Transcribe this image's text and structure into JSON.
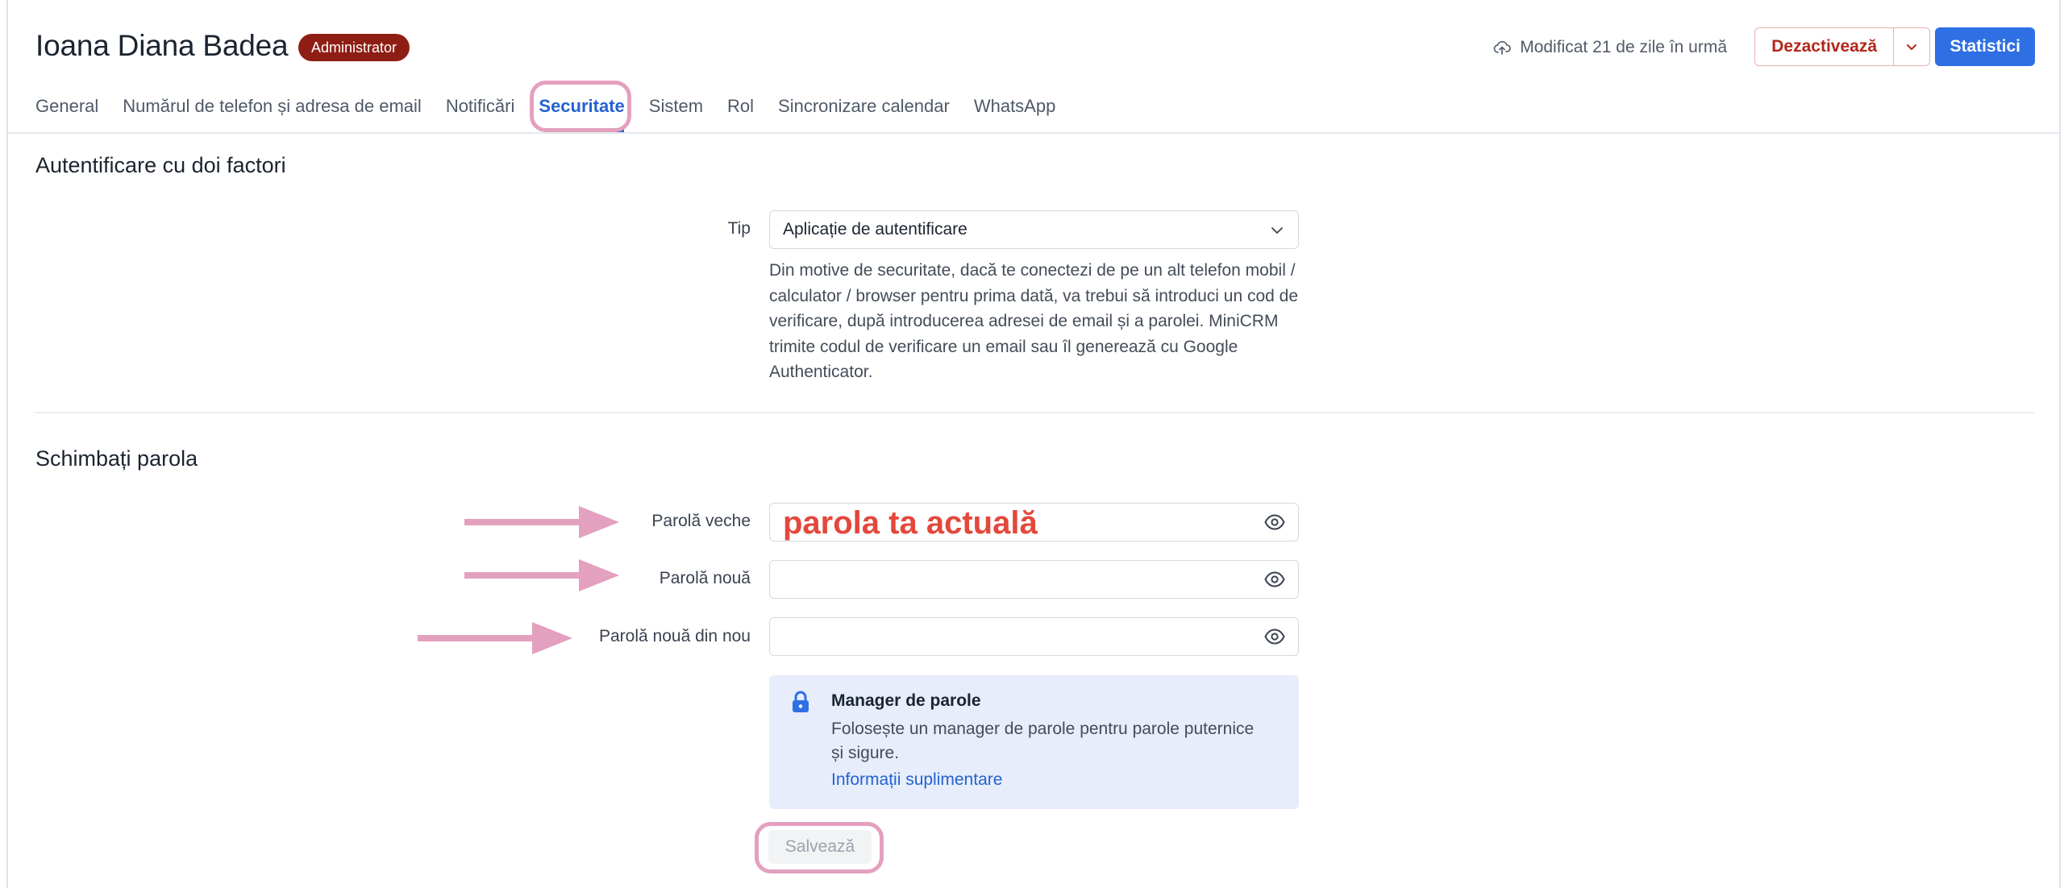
{
  "header": {
    "user_name": "Ioana Diana Badea",
    "role_badge": "Administrator",
    "modified_text": "Modificat 21 de zile în urmă",
    "deactivate_label": "Dezactivează",
    "stats_label": "Statistici"
  },
  "tabs": [
    {
      "label": "General"
    },
    {
      "label": "Numărul de telefon și adresa de email"
    },
    {
      "label": "Notificări"
    },
    {
      "label": "Securitate"
    },
    {
      "label": "Sistem"
    },
    {
      "label": "Rol"
    },
    {
      "label": "Sincronizare calendar"
    },
    {
      "label": "WhatsApp"
    }
  ],
  "active_tab": "Securitate",
  "two_factor": {
    "title": "Autentificare cu doi factori",
    "type_label": "Tip",
    "type_value": "Aplicație de autentificare",
    "help_text": "Din motive de securitate, dacă te conectezi de pe un alt telefon mobil / calculator / browser pentru prima dată, va trebui să introduci un cod de verificare, după introducerea adresei de email și a parolei. MiniCRM trimite codul de verificare un email sau îl generează cu Google Authenticator."
  },
  "change_password": {
    "title": "Schimbați parola",
    "old_label": "Parolă veche",
    "old_value": "parola ta actuală",
    "new_label": "Parolă nouă",
    "new_value": "",
    "repeat_label": "Parolă nouă din nou",
    "repeat_value": ""
  },
  "password_manager": {
    "title": "Manager de parole",
    "description": "Folosește un manager de parole pentru parole puternice și sigure.",
    "link": "Informații suplimentare"
  },
  "save_label": "Salvează",
  "colors": {
    "accent": "#2362d1",
    "primary_button": "#2e6fe4",
    "danger": "#b3261b",
    "badge": "#8e1e14",
    "annotation": "#e4a0bf",
    "handwritten": "#e4473b",
    "info_bg": "#e7edfa"
  }
}
